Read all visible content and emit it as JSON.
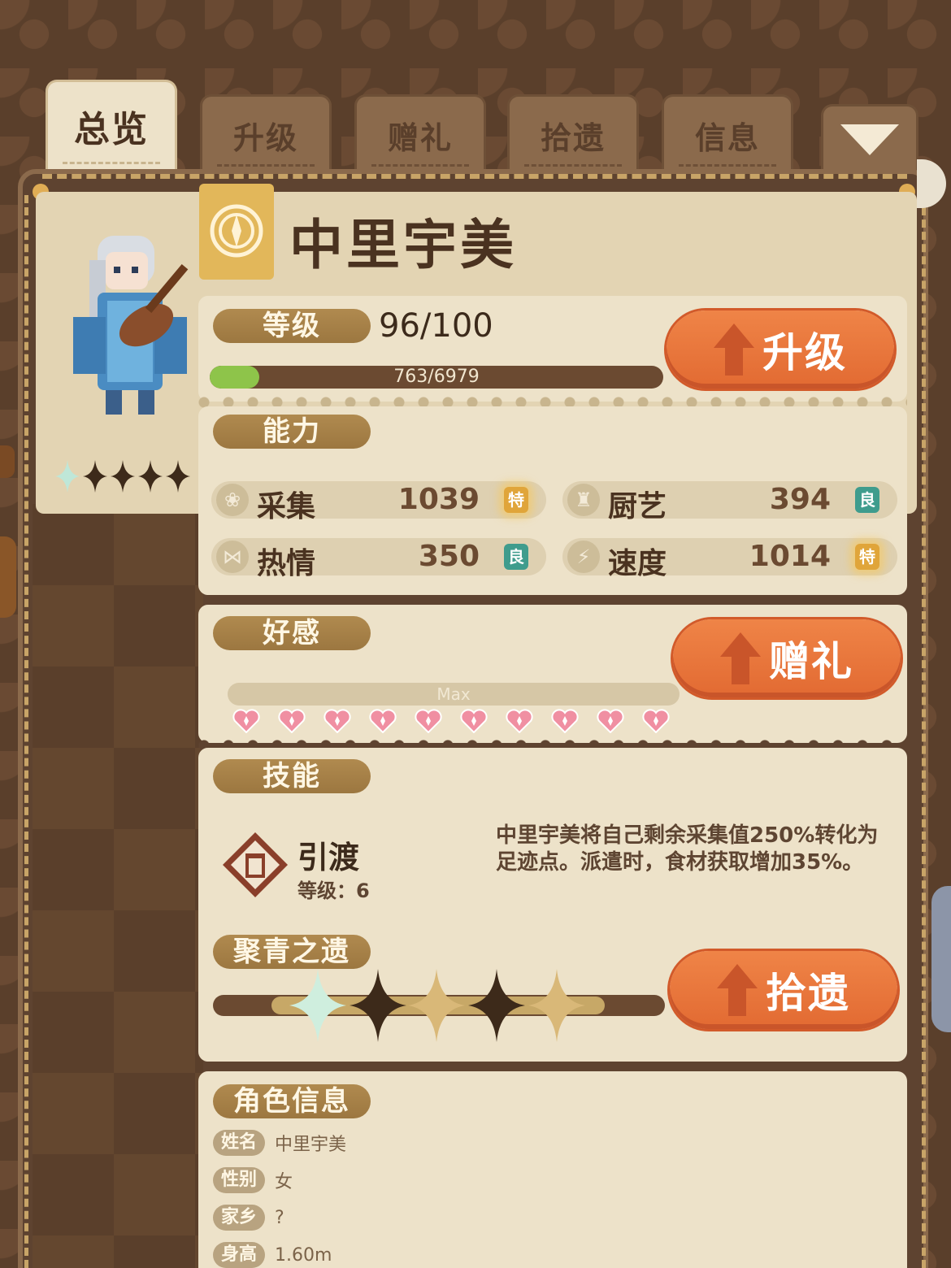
{
  "tabs": [
    {
      "label": "总览",
      "active": true
    },
    {
      "label": "升级",
      "active": false
    },
    {
      "label": "赠礼",
      "active": false
    },
    {
      "label": "拾遗",
      "active": false
    },
    {
      "label": "信息",
      "active": false
    }
  ],
  "character": {
    "name": "中里宇美",
    "star_count": 5
  },
  "level": {
    "pill": "等级",
    "value": "96/100",
    "exp_text": "763/6979",
    "exp_current": 763,
    "exp_max": 6979,
    "button": "升级"
  },
  "ability": {
    "pill": "能力",
    "stats": [
      {
        "icon": "leaf-icon",
        "name": "采集",
        "value": "1039",
        "grade": "特",
        "grade_color": "#e0a53a"
      },
      {
        "icon": "chef-hat-icon",
        "name": "厨艺",
        "value": "394",
        "grade": "良",
        "grade_color": "#3f9c8d"
      },
      {
        "icon": "bow-icon",
        "name": "热情",
        "value": "350",
        "grade": "良",
        "grade_color": "#3f9c8d"
      },
      {
        "icon": "lightning-icon",
        "name": "速度",
        "value": "1014",
        "grade": "特",
        "grade_color": "#e0a53a"
      }
    ]
  },
  "favor": {
    "pill": "好感",
    "bar_text": "Max",
    "hearts": 10,
    "button": "赠礼",
    "heart_color": "#f08fa2"
  },
  "skill": {
    "pill": "技能",
    "name": "引渡",
    "level": "等级：6",
    "description": "中里宇美将自己剩余采集值250%转化为足迹点。派遣时，食材获取增加35%。"
  },
  "relic": {
    "pill": "聚青之遗",
    "button": "拾遗",
    "stars": [
      "shiny",
      "dark",
      "gold",
      "dark",
      "gold"
    ]
  },
  "info": {
    "pill": "角色信息",
    "rows": [
      {
        "key": "姓名",
        "value": "中里宇美"
      },
      {
        "key": "性别",
        "value": "女"
      },
      {
        "key": "家乡",
        "value": "?"
      },
      {
        "key": "身高",
        "value": "1.60m"
      }
    ]
  },
  "colors": {
    "accent_orange": "#e26a32",
    "pill_brown": "#9c7740",
    "card_bg": "#ede2c9",
    "exp_green": "#8ec44a"
  }
}
